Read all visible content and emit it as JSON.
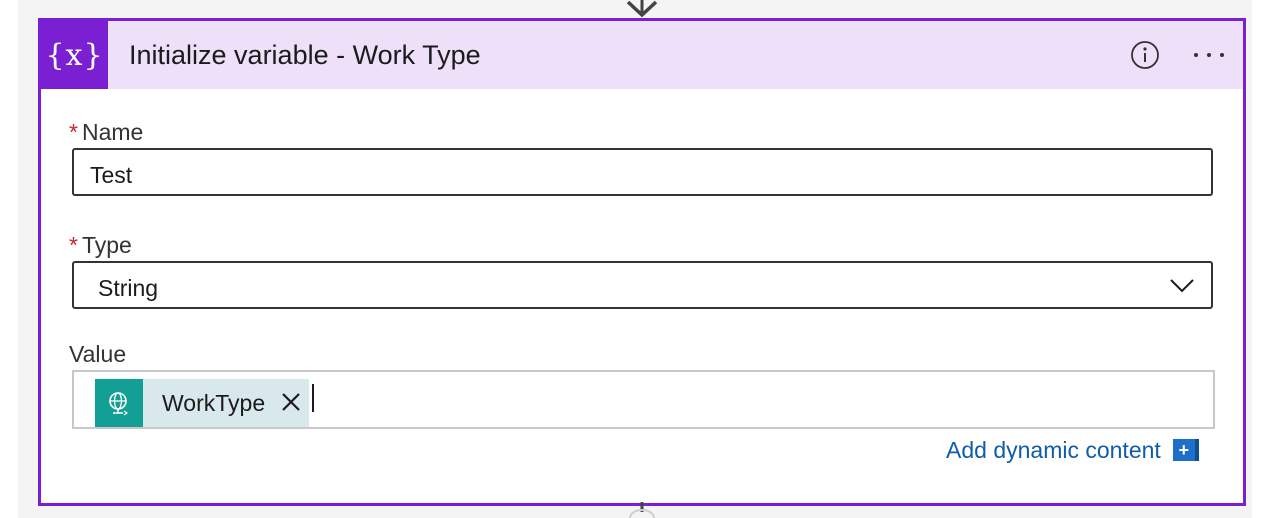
{
  "action": {
    "icon_glyph": "{x}",
    "icon": "variable-icon",
    "title": "Initialize variable - Work Type",
    "info_icon": "info-icon",
    "more_icon": "more-options-icon"
  },
  "fields": {
    "name": {
      "required_mark": "*",
      "label": "Name",
      "value": "Test"
    },
    "type": {
      "required_mark": "*",
      "label": "Type",
      "value": "String",
      "dropdown_icon": "chevron-down-icon"
    },
    "value": {
      "label": "Value",
      "token": {
        "icon": "globe-trigger-icon",
        "label": "WorkType",
        "remove_icon": "close-icon"
      }
    }
  },
  "add_dynamic_content": {
    "label": "Add dynamic content",
    "icon_glyph": "+"
  },
  "colors": {
    "accent": "#7a1fd1",
    "header_bg": "#ede0f8",
    "token_icon_bg": "#12a096",
    "token_bg": "#d9e8ec",
    "link": "#0f5cab",
    "required": "#c4262e"
  }
}
